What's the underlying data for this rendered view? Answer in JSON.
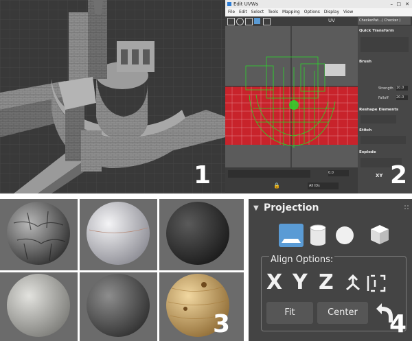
{
  "panels": {
    "p1": {
      "number": "1"
    },
    "p2": {
      "number": "2"
    },
    "p3": {
      "number": "3"
    },
    "p4": {
      "number": "4"
    }
  },
  "uv_editor": {
    "title": "Edit UVWs",
    "menu": [
      "File",
      "Edit",
      "Select",
      "Tools",
      "Mapping",
      "Options",
      "Display",
      "View"
    ],
    "toolbar_label": "UV",
    "checker_dropdown": "CheckerPat...( Checker )",
    "sections": [
      "Quick Transform",
      "Brush",
      "Reshape Elements",
      "Stitch",
      "Explode"
    ],
    "brush_strength_label": "Strength",
    "brush_strength_value": "10.0",
    "brush_falloff_label": "Falloff",
    "brush_falloff_value": "20.0",
    "bottom_value": "0.0",
    "all_ids": "All IDs",
    "axis_label": "XY"
  },
  "projection": {
    "title": "Projection",
    "align_options_label": "Align Options:",
    "axis_x": "X",
    "axis_y": "Y",
    "axis_z": "Z",
    "fit_label": "Fit",
    "center_label": "Center"
  },
  "colors": {
    "uv_red": "#c8232b",
    "uv_green": "#2bd62b",
    "active_blue": "#5a9bd5",
    "panel_gray": "#444444"
  }
}
